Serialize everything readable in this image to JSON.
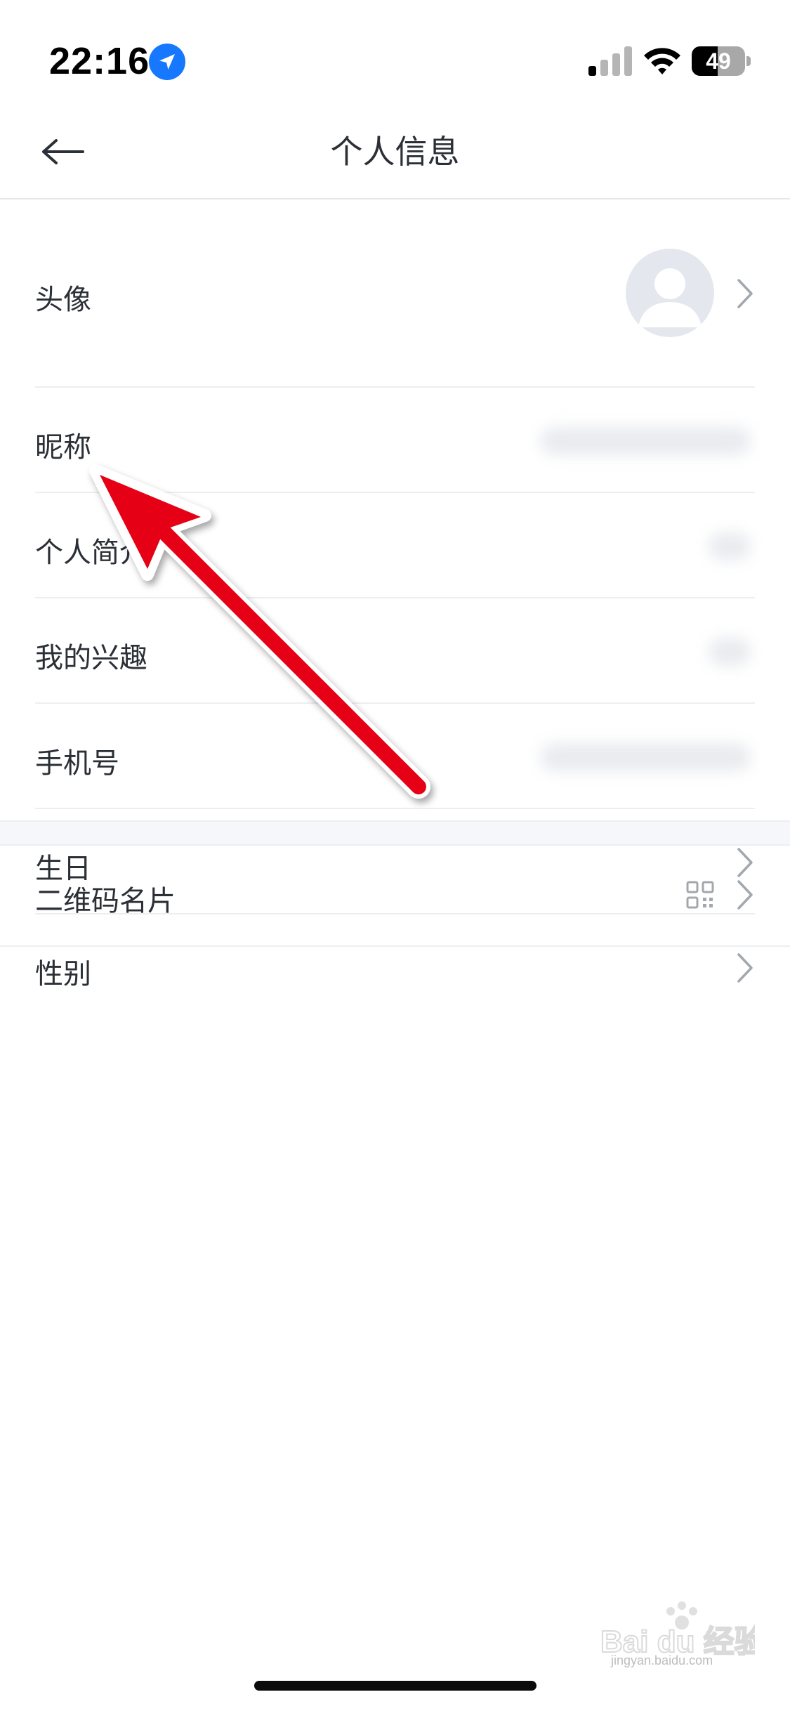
{
  "status_bar": {
    "time": "22:16",
    "battery_level": "49",
    "battery_fraction": 0.49,
    "icons": {
      "location": "location-arrow-icon",
      "signal": "cellular-signal-icon",
      "wifi": "wifi-icon",
      "battery": "battery-icon"
    },
    "colors": {
      "location": "#1677ff"
    }
  },
  "header": {
    "title": "个人信息",
    "back_icon": "back-arrow-icon"
  },
  "rows": {
    "avatar": {
      "label": "头像"
    },
    "nickname": {
      "label": "昵称"
    },
    "bio": {
      "label": "个人简介"
    },
    "interests": {
      "label": "我的兴趣"
    },
    "phone": {
      "label": "手机号"
    },
    "birthday": {
      "label": "生日"
    },
    "gender": {
      "label": "性别"
    },
    "qr_card": {
      "label": "二维码名片"
    }
  },
  "annotation": {
    "arrow_color": "#e60012"
  },
  "watermark": {
    "brand": "Bai du 经验",
    "url": "jingyan.baidu.com"
  }
}
